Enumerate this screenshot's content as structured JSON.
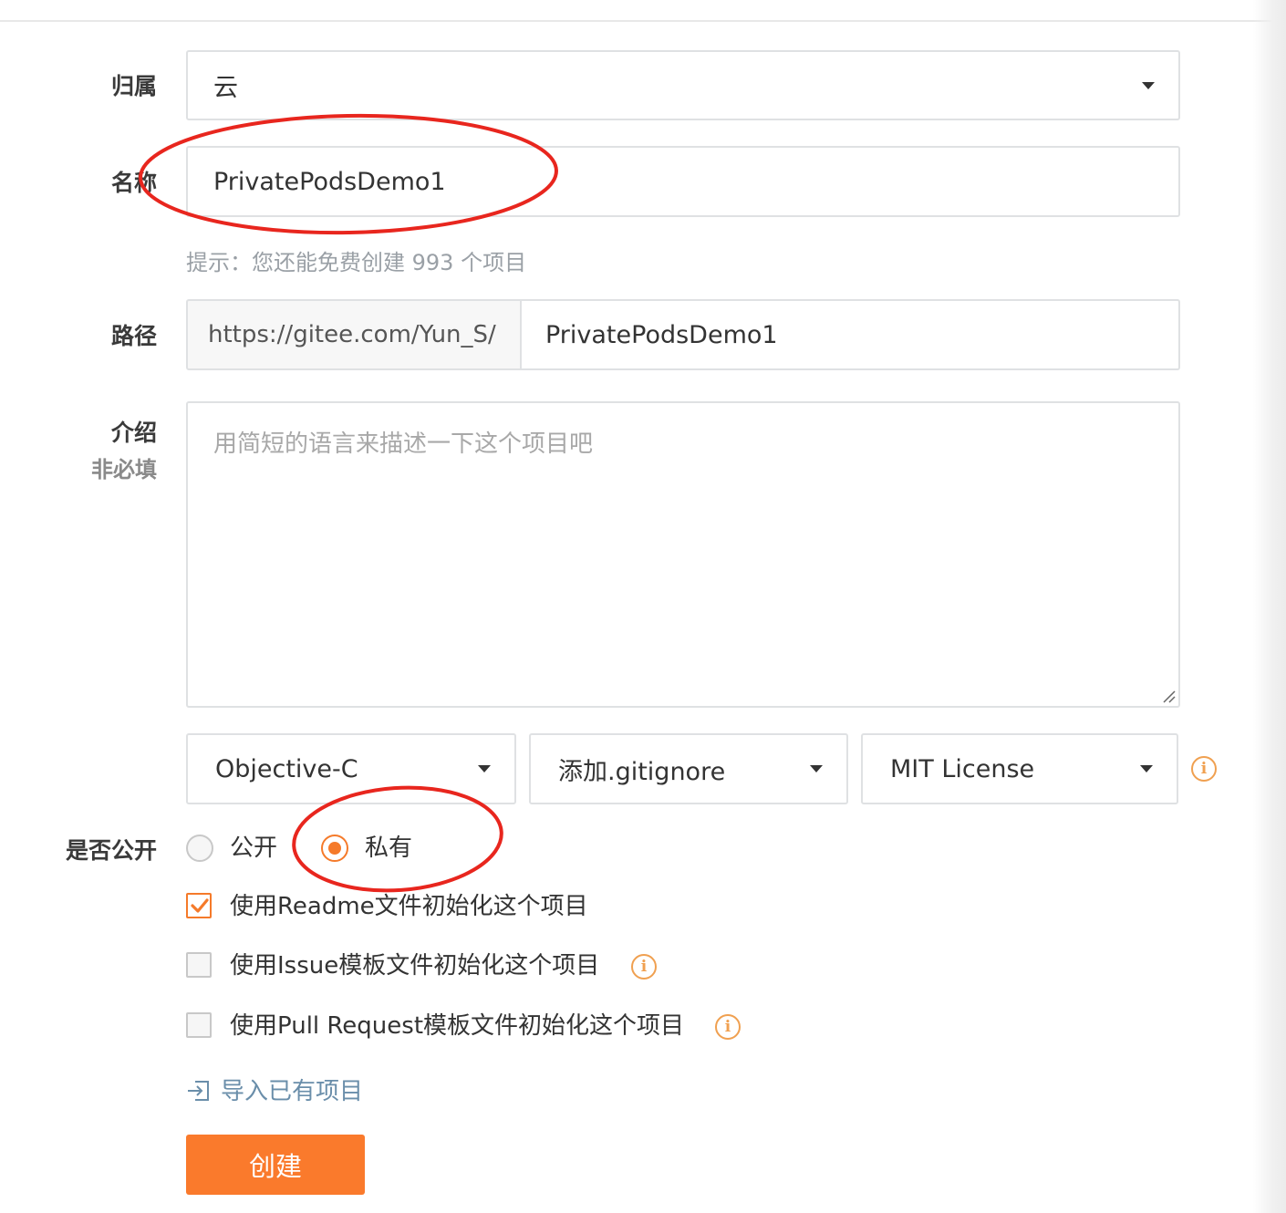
{
  "form": {
    "owner": {
      "label": "归属",
      "value": "云"
    },
    "name": {
      "label": "名称",
      "value": "PrivatePodsDemo1"
    },
    "hint": "提示：您还能免费创建 993 个项目",
    "path": {
      "label": "路径",
      "prefix": "https://gitee.com/Yun_S/",
      "value": "PrivatePodsDemo1"
    },
    "description": {
      "label": "介绍",
      "sub_label": "非必填",
      "placeholder": "用简短的语言来描述一下这个项目吧",
      "value": ""
    },
    "language": {
      "value": "Objective-C"
    },
    "gitignore": {
      "value": "添加.gitignore"
    },
    "license": {
      "value": "MIT License"
    },
    "visibility": {
      "label": "是否公开",
      "options": [
        {
          "label": "公开",
          "selected": false
        },
        {
          "label": "私有",
          "selected": true
        }
      ]
    },
    "init_options": [
      {
        "label": "使用Readme文件初始化这个项目",
        "checked": true,
        "info": false
      },
      {
        "label": "使用Issue模板文件初始化这个项目",
        "checked": false,
        "info": true
      },
      {
        "label": "使用Pull Request模板文件初始化这个项目",
        "checked": false,
        "info": true
      }
    ],
    "import_link": "导入已有项目",
    "submit_label": "创建"
  },
  "icons": {
    "info": "info-circle-icon",
    "dropdown": "caret-down-icon",
    "import": "import-icon",
    "check": "check-icon"
  },
  "colors": {
    "accent": "#fa7a2c",
    "info": "#f0a050",
    "annotation": "#e8261e",
    "link": "#6a8eaa"
  }
}
